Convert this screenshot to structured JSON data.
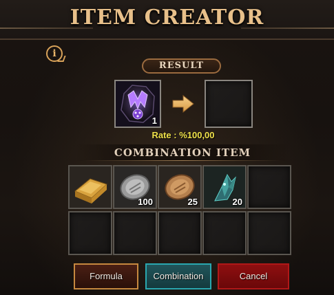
{
  "header": {
    "title": "ITEM CREATOR"
  },
  "info_icon": "info-icon",
  "result": {
    "label": "RESULT",
    "source_item": {
      "icon": "purple-rune-stone-icon",
      "quantity": "1"
    },
    "arrow_icon": "arrow-right-icon",
    "result_item": null,
    "rate": "Rate : %100,00"
  },
  "combination": {
    "label": "COMBINATION ITEM",
    "items": [
      {
        "icon": "gold-bar-icon",
        "quantity": ""
      },
      {
        "icon": "silver-coin-icon",
        "quantity": "100"
      },
      {
        "icon": "bronze-coin-icon",
        "quantity": "25"
      },
      {
        "icon": "teal-crystal-shard-icon",
        "quantity": "20"
      },
      {
        "icon": "",
        "quantity": ""
      },
      {
        "icon": "",
        "quantity": ""
      },
      {
        "icon": "",
        "quantity": ""
      },
      {
        "icon": "",
        "quantity": ""
      },
      {
        "icon": "",
        "quantity": ""
      },
      {
        "icon": "",
        "quantity": ""
      }
    ]
  },
  "buttons": {
    "formula": "Formula",
    "combination": "Combination",
    "cancel": "Cancel"
  },
  "colors": {
    "title": "#e8c08a",
    "rate": "#f0e24a",
    "formula_border": "#c7893f",
    "combination_border": "#2aa8b0",
    "cancel_fill": "#8e0f10"
  }
}
